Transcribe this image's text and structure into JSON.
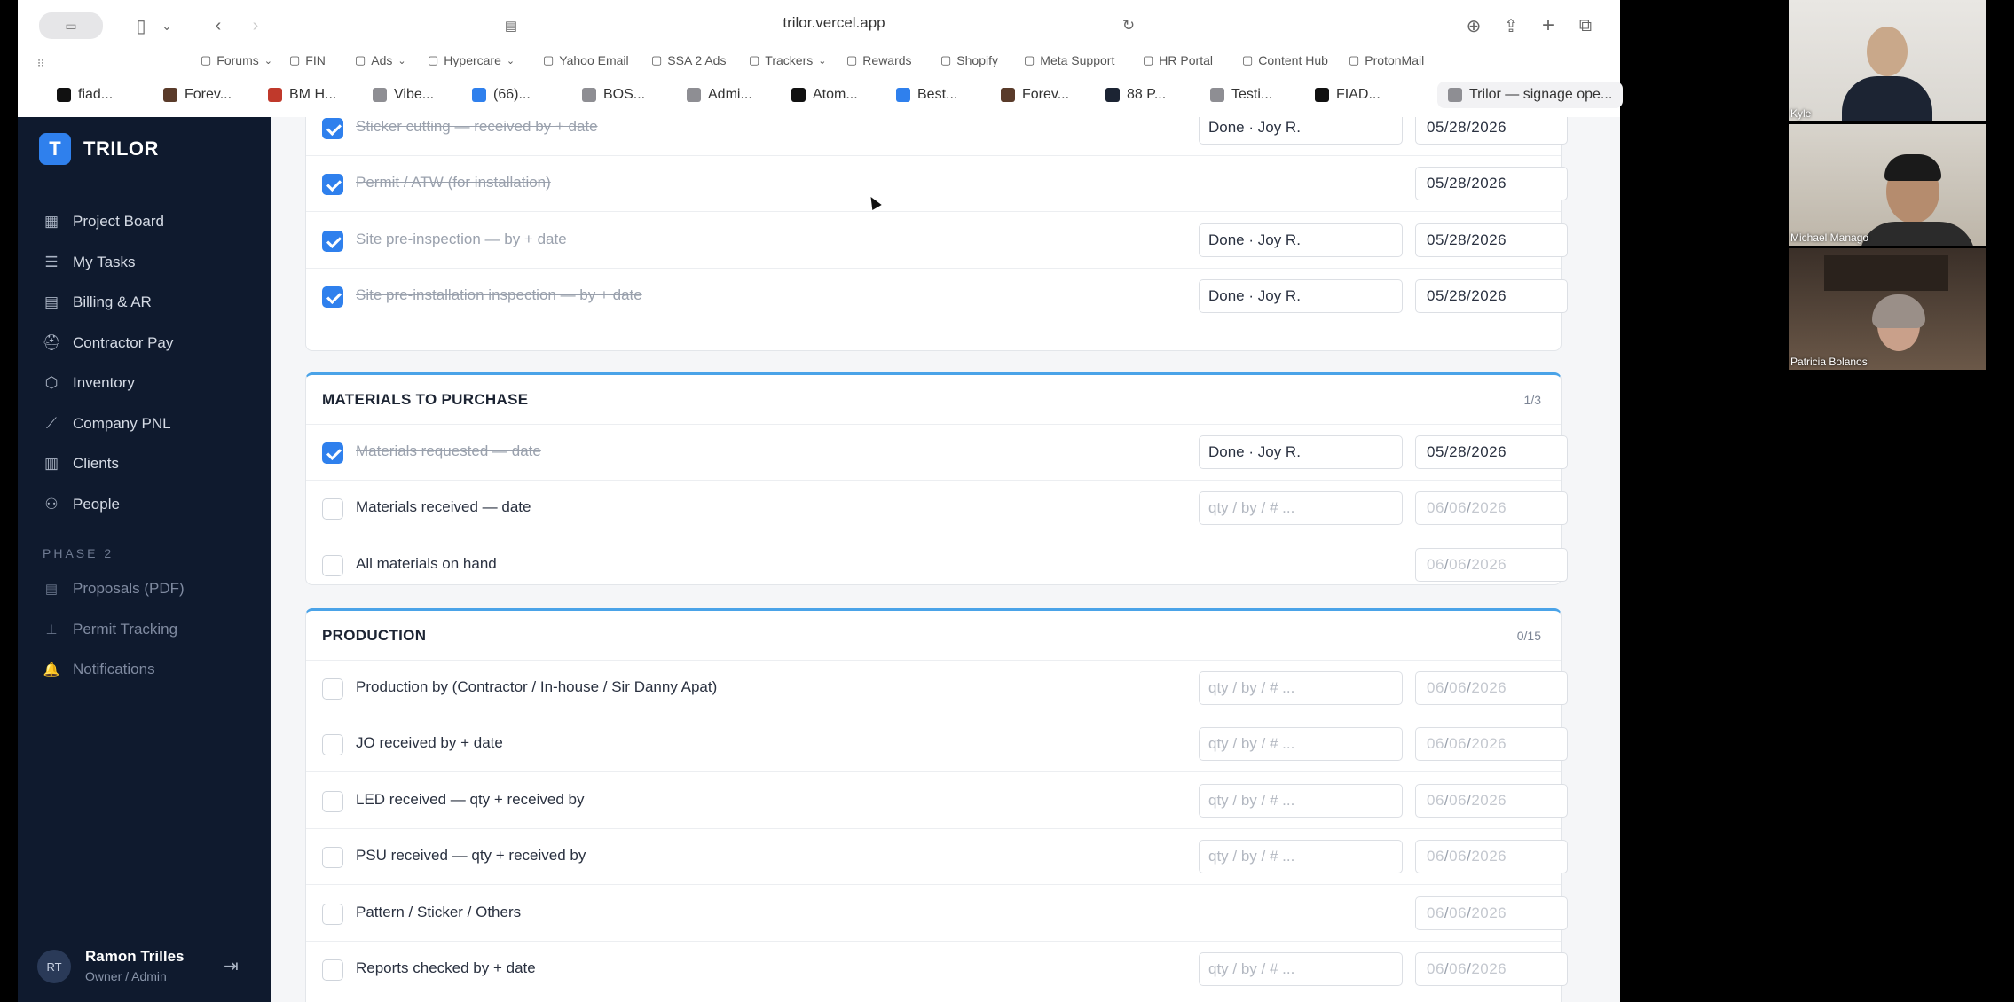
{
  "browser": {
    "url": "trilor.vercel.app",
    "bookmarks": [
      {
        "label": "Forums",
        "icon": "folder-icon",
        "caret": true
      },
      {
        "label": "FIN",
        "icon": "table-icon",
        "caret": false
      },
      {
        "label": "Ads",
        "icon": "folder-icon",
        "caret": true
      },
      {
        "label": "Hypercare",
        "icon": "folder-icon",
        "caret": true
      },
      {
        "label": "Yahoo Email",
        "icon": "yahoo-icon",
        "caret": false
      },
      {
        "label": "SSA 2 Ads",
        "icon": "meta-icon",
        "caret": false
      },
      {
        "label": "Trackers",
        "icon": "folder-icon",
        "caret": true
      },
      {
        "label": "Rewards",
        "icon": "table-icon",
        "caret": false
      },
      {
        "label": "Shopify",
        "icon": "globe-icon",
        "caret": false
      },
      {
        "label": "Meta Support",
        "icon": "facebook-icon",
        "caret": false
      },
      {
        "label": "HR Portal",
        "icon": "bolt-icon",
        "caret": false
      },
      {
        "label": "Content Hub",
        "icon": "content-hub-icon",
        "caret": false
      },
      {
        "label": "ProtonMail",
        "icon": "proton-icon",
        "caret": false
      }
    ],
    "tabs": [
      {
        "label": "fiad...",
        "color": "#111111"
      },
      {
        "label": "Forev...",
        "color": "#5a3b2a"
      },
      {
        "label": "BM H...",
        "color": "#c0392b"
      },
      {
        "label": "Vibe...",
        "color": "#8e8e93"
      },
      {
        "label": "(66)...",
        "color": "#2f80ed"
      },
      {
        "label": "BOS...",
        "color": "#8e8e93"
      },
      {
        "label": "Admi...",
        "color": "#8e8e93"
      },
      {
        "label": "Atom...",
        "color": "#111111"
      },
      {
        "label": "Best...",
        "color": "#2f80ed"
      },
      {
        "label": "Forev...",
        "color": "#5a3b2a"
      },
      {
        "label": "88 P...",
        "color": "#1c2433"
      },
      {
        "label": "Testi...",
        "color": "#8e8e93"
      },
      {
        "label": "FIAD...",
        "color": "#111111"
      },
      {
        "label": "Trilor — signage ope...",
        "color": "#8e8e93"
      }
    ]
  },
  "app": {
    "brand": "TRILOR",
    "brand_initial": "T",
    "nav": [
      {
        "label": "Project Board",
        "icon": "grid-icon",
        "glyph": "▦"
      },
      {
        "label": "My Tasks",
        "icon": "checklist-icon",
        "glyph": "☰"
      },
      {
        "label": "Billing & AR",
        "icon": "document-icon",
        "glyph": "▤"
      },
      {
        "label": "Contractor Pay",
        "icon": "helmet-icon",
        "glyph": "⛑"
      },
      {
        "label": "Inventory",
        "icon": "box-icon",
        "glyph": "⬡"
      },
      {
        "label": "Company PNL",
        "icon": "chart-line-icon",
        "glyph": "⟋"
      },
      {
        "label": "Clients",
        "icon": "building-icon",
        "glyph": "▥"
      },
      {
        "label": "People",
        "icon": "people-icon",
        "glyph": "⚇"
      }
    ],
    "phase_label": "PHASE 2",
    "phase_nav": [
      {
        "label": "Proposals (PDF)",
        "icon": "document-icon",
        "glyph": "▤"
      },
      {
        "label": "Permit Tracking",
        "icon": "stamp-icon",
        "glyph": "⊥"
      },
      {
        "label": "Notifications",
        "icon": "bell-icon",
        "glyph": "🔔"
      }
    ],
    "user": {
      "initials": "RT",
      "name": "Ramon Trilles",
      "role": "Owner / Admin"
    }
  },
  "sections": {
    "top": {
      "rows": [
        {
          "label": "Sticker cutting — received by + date",
          "checked": true,
          "field1": "Done · Joy R.",
          "date": "05/28/2026"
        },
        {
          "label": "Permit / ATW (for installation)",
          "checked": true,
          "field1": null,
          "date": "05/28/2026"
        },
        {
          "label": "Site pre-inspection — by + date",
          "checked": true,
          "field1": "Done · Joy R.",
          "date": "05/28/2026"
        },
        {
          "label": "Site pre-installation inspection — by + date",
          "checked": true,
          "field1": "Done · Joy R.",
          "date": "05/28/2026"
        }
      ]
    },
    "materials": {
      "title": "MATERIALS TO PURCHASE",
      "count": "1/3",
      "rows": [
        {
          "label": "Materials requested — date",
          "checked": true,
          "field1": "Done · Joy R.",
          "date": "05/28/2026"
        },
        {
          "label": "Materials received — date",
          "checked": false,
          "field1_placeholder": "qty / by / # ...",
          "date_placeholder": [
            "06",
            "06",
            "2026"
          ]
        },
        {
          "label": "All materials on hand",
          "checked": false,
          "field1_placeholder": null,
          "date_placeholder": [
            "06",
            "06",
            "2026"
          ]
        }
      ]
    },
    "production": {
      "title": "PRODUCTION",
      "count": "0/15",
      "rows": [
        {
          "label": "Production by (Contractor / In-house / Sir Danny Apat)",
          "checked": false,
          "field1_placeholder": "qty / by / # ...",
          "date_placeholder": [
            "06",
            "06",
            "2026"
          ]
        },
        {
          "label": "JO received by + date",
          "checked": false,
          "field1_placeholder": "qty / by / # ...",
          "date_placeholder": [
            "06",
            "06",
            "2026"
          ]
        },
        {
          "label": "LED received — qty + received by",
          "checked": false,
          "field1_placeholder": "qty / by / # ...",
          "date_placeholder": [
            "06",
            "06",
            "2026"
          ]
        },
        {
          "label": "PSU received — qty + received by",
          "checked": false,
          "field1_placeholder": "qty / by / # ...",
          "date_placeholder": [
            "06",
            "06",
            "2026"
          ]
        },
        {
          "label": "Pattern / Sticker / Others",
          "checked": false,
          "field1_placeholder": null,
          "date_placeholder": [
            "06",
            "06",
            "2026"
          ]
        },
        {
          "label": "Reports checked by + date",
          "checked": false,
          "field1_placeholder": "qty / by / # ...",
          "date_placeholder": [
            "06",
            "06",
            "2026"
          ]
        }
      ]
    }
  },
  "call": {
    "participants": [
      "Kyle",
      "Michael Manago",
      "Patricia Bolanos"
    ]
  }
}
